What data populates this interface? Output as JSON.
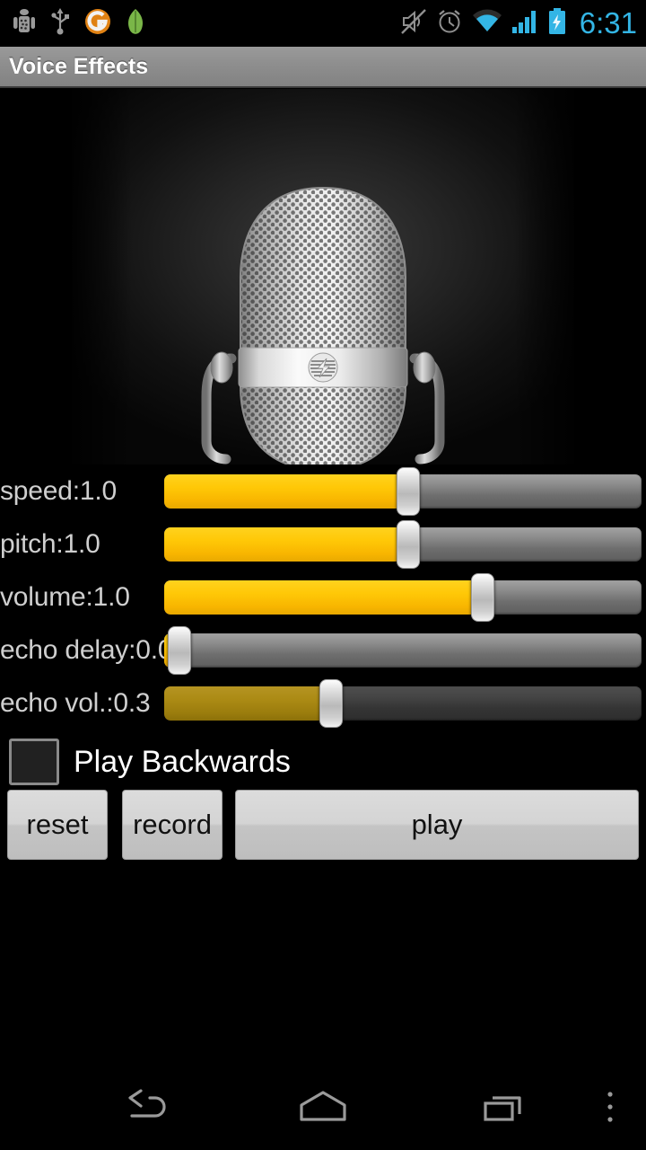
{
  "statusbar": {
    "left_icons": [
      "android-robot-icon",
      "usb-icon",
      "orange-circle-app-icon",
      "leaf-icon"
    ],
    "right_icons": [
      "mute-icon",
      "alarm-clock-icon",
      "wifi-icon",
      "cellular-signal-icon",
      "battery-charging-icon"
    ],
    "clock": "6:31",
    "accent_color": "#33b5e5"
  },
  "titlebar": {
    "title": "Voice Effects"
  },
  "hero": {
    "image_name": "retro-microphone-image"
  },
  "sliders": [
    {
      "label": "speed:1.0",
      "name": "speed",
      "value": 1.0,
      "percent": 49,
      "dim": false
    },
    {
      "label": "pitch:1.0",
      "name": "pitch",
      "value": 1.0,
      "percent": 49,
      "dim": false
    },
    {
      "label": "volume:1.0",
      "name": "volume",
      "value": 1.0,
      "percent": 65,
      "dim": false
    },
    {
      "label": "echo delay:0.0",
      "name": "echo-delay",
      "value": 0.0,
      "percent": 1,
      "dim": false
    },
    {
      "label": "echo vol.:0.3",
      "name": "echo-volume",
      "value": 0.3,
      "percent": 35,
      "dim": true
    }
  ],
  "checkbox": {
    "label": "Play Backwards",
    "checked": false
  },
  "buttons": {
    "reset": "reset",
    "record": "record",
    "play": "play"
  },
  "navbar": {
    "back": "back-icon",
    "home": "home-icon",
    "recents": "recents-icon",
    "menu": "overflow-menu-icon"
  },
  "colors": {
    "slider_fill": "#ffc807",
    "slider_fill_dim": "#a8891a",
    "track": "#8d8d8d",
    "background": "#000000",
    "titlebar": "#8e8e8e"
  }
}
